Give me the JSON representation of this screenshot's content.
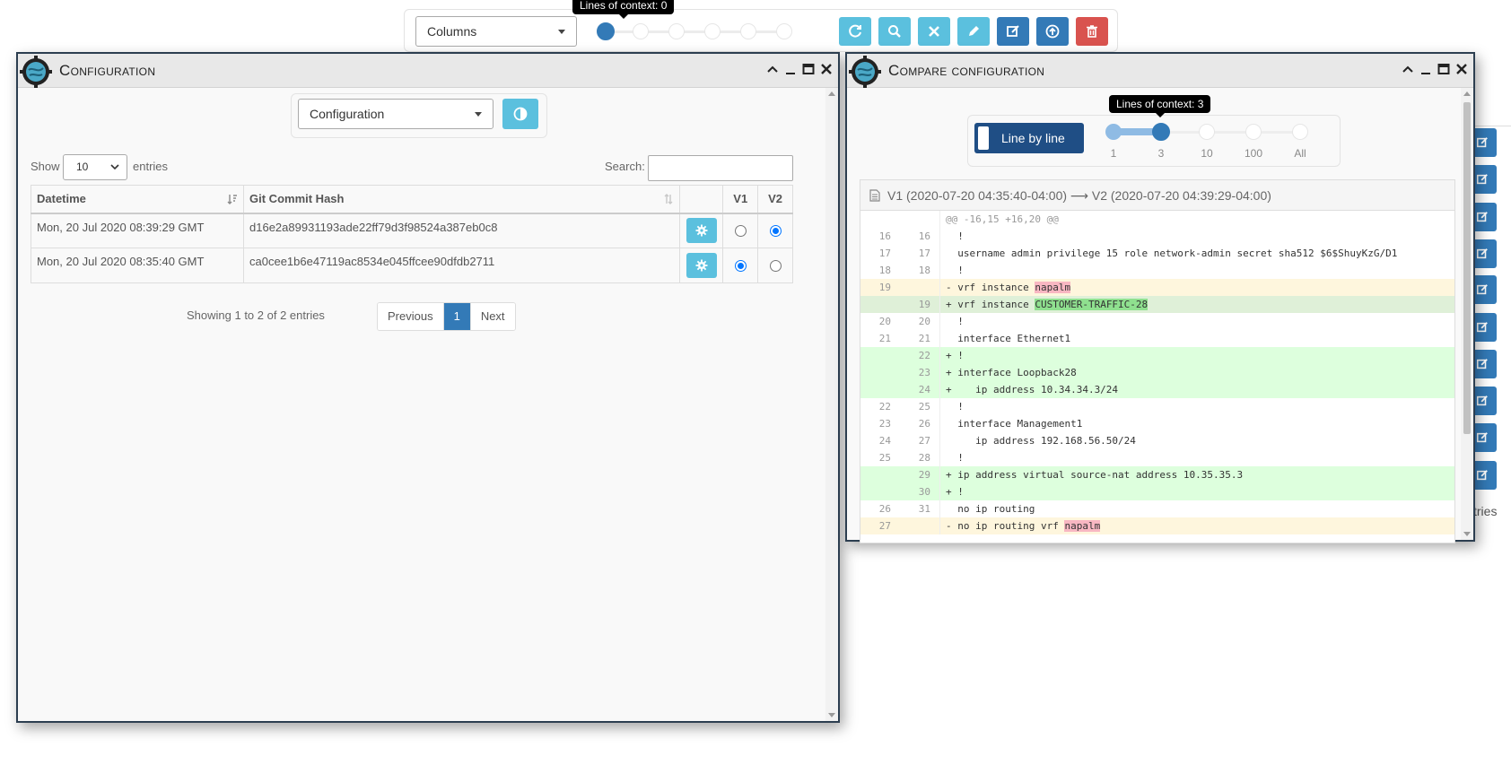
{
  "toolbar": {
    "columns_select": "Columns",
    "tooltip": "Lines of context: 0"
  },
  "bg_text": {
    "entries_suffix": "tries"
  },
  "config_window": {
    "title": "Configuration",
    "type_select": "Configuration",
    "show_label": "Show",
    "page_size": "10",
    "entries_label": "entries",
    "search_label": "Search:",
    "search_value": "",
    "columns": [
      "Datetime",
      "Git Commit Hash",
      "",
      "V1",
      "V2"
    ],
    "rows": [
      {
        "datetime": "Mon, 20 Jul 2020 08:39:29 GMT",
        "hash": "d16e2a89931193ade22ff79d3f98524a387eb0c8",
        "v1": false,
        "v2": true
      },
      {
        "datetime": "Mon, 20 Jul 2020 08:35:40 GMT",
        "hash": "ca0cee1b6e47119ac8534e045ffcee90dfdb2711",
        "v1": true,
        "v2": false
      }
    ],
    "info": "Showing 1 to 2 of 2 entries",
    "pager": {
      "previous": "Previous",
      "current": "1",
      "next": "Next"
    }
  },
  "compare_window": {
    "title": "Compare configuration",
    "mode_button": "Line by line",
    "tooltip": "Lines of context: 3",
    "context_options": [
      "1",
      "3",
      "10",
      "100",
      "All"
    ],
    "context_selected": "3",
    "diff_header": "V1 (2020-07-20 04:35:40-04:00) ⟶ V2 (2020-07-20 04:39:29-04:00)",
    "hunk": "@@ -16,15 +16,20 @@",
    "lines": [
      {
        "type": "ctx",
        "old": "16",
        "new": "16",
        "text": "  !"
      },
      {
        "type": "ctx",
        "old": "17",
        "new": "17",
        "text": "  username admin privilege 15 role network-admin secret sha512 $6$ShuyKzG/D1"
      },
      {
        "type": "ctx",
        "old": "18",
        "new": "18",
        "text": "  !"
      },
      {
        "type": "del",
        "old": "19",
        "new": "",
        "prefix": "- vrf instance ",
        "hl": "napalm",
        "suffix": ""
      },
      {
        "type": "ins",
        "old": "",
        "new": "19",
        "prefix": "+ vrf instance ",
        "hl": "CUSTOMER-TRAFFIC-28",
        "suffix": ""
      },
      {
        "type": "ctx",
        "old": "20",
        "new": "20",
        "text": "  !"
      },
      {
        "type": "ctx",
        "old": "21",
        "new": "21",
        "text": "  interface Ethernet1"
      },
      {
        "type": "add",
        "old": "",
        "new": "22",
        "text": "+ !"
      },
      {
        "type": "add",
        "old": "",
        "new": "23",
        "text": "+ interface Loopback28"
      },
      {
        "type": "add",
        "old": "",
        "new": "24",
        "text": "+    ip address 10.34.34.3/24"
      },
      {
        "type": "ctx",
        "old": "22",
        "new": "25",
        "text": "  !"
      },
      {
        "type": "ctx",
        "old": "23",
        "new": "26",
        "text": "  interface Management1"
      },
      {
        "type": "ctx",
        "old": "24",
        "new": "27",
        "text": "     ip address 192.168.56.50/24"
      },
      {
        "type": "ctx",
        "old": "25",
        "new": "28",
        "text": "  !"
      },
      {
        "type": "add",
        "old": "",
        "new": "29",
        "text": "+ ip address virtual source-nat address 10.35.35.3"
      },
      {
        "type": "add",
        "old": "",
        "new": "30",
        "text": "+ !"
      },
      {
        "type": "ctx",
        "old": "26",
        "new": "31",
        "text": "  no ip routing"
      },
      {
        "type": "del",
        "old": "27",
        "new": "",
        "prefix": "- no ip routing vrf ",
        "hl": "napalm",
        "suffix": ""
      }
    ]
  },
  "colors": {
    "primary": "#337ab7",
    "info": "#5bc0de",
    "danger": "#d9534f",
    "window_border": "#2c3e50"
  }
}
